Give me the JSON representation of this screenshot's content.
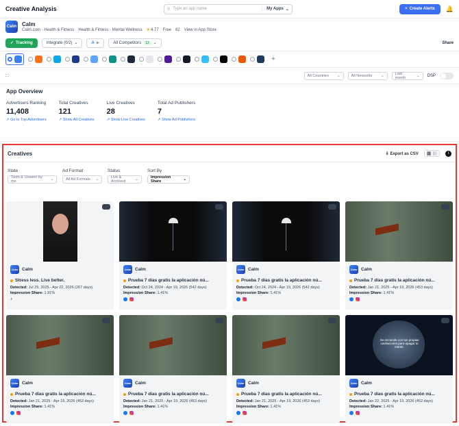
{
  "header": {
    "title": "Creative Analysis",
    "search_placeholder": "Type an app name",
    "my_apps": "My Apps",
    "create_alerts": "Create Alerts"
  },
  "app": {
    "name": "Calm",
    "logo_text": "Calm",
    "developer": "Calm.com - Health & Fitness",
    "category": "Health & Fitness - Mental Wellness",
    "rating": "4.77",
    "price": "Free",
    "downloads": "82",
    "store_link": "View in App Store"
  },
  "toolbar": {
    "tracking": "Tracking",
    "integrate": "Integrate (0/2)",
    "competitors": "All Competitors",
    "competitors_badge": "13",
    "share": "Share"
  },
  "app_icons": [
    "#3b82f6",
    "#f97316",
    "#0ea5e9",
    "#1e3a8a",
    "#60a5fa",
    "#0d9488",
    "#1e293b",
    "#e5e7eb",
    "#4c1d95",
    "#111827",
    "#38bdf8",
    "#000000",
    "#ea580c",
    "#1e3a5f"
  ],
  "filters": {
    "countries": "All Countries",
    "networks": "All Networks",
    "period": "Last month",
    "dsp": "DSP"
  },
  "overview": {
    "title": "App Overview",
    "stats": [
      {
        "label": "Advertisers Ranking",
        "value": "11,408",
        "link": "Go to Top Advertisers"
      },
      {
        "label": "Total Creatives",
        "value": "121",
        "link": "Show All Creatives"
      },
      {
        "label": "Live Creatives",
        "value": "28",
        "link": "Show Live Creatives"
      },
      {
        "label": "Total Ad Publishers",
        "value": "7",
        "link": "Show Ad Publishers"
      }
    ]
  },
  "creatives": {
    "title": "Creatives",
    "export": "Export as CSV",
    "filters": [
      {
        "label": "State",
        "value": "Seen & Unseen by me"
      },
      {
        "label": "Ad Format",
        "value": "All Ad Formats"
      },
      {
        "label": "Status",
        "value": "Live & Archived"
      },
      {
        "label": "Sort By",
        "value": "Impression Share"
      }
    ],
    "detected_label": "Detected:",
    "share_label": "Impression Share:",
    "cards": [
      {
        "brand": "Calm",
        "title": "Stress less. Live better.",
        "detected": "Jul 29, 2025 - Apr 22, 2026 (267 days)",
        "share": "1.91%",
        "thumb": "face",
        "platforms": [
          "tiktok"
        ]
      },
      {
        "brand": "Calm",
        "title": "Prueba 7 días gratis la aplicación nú...",
        "detected": "Oct 24, 2024 - Apr 19, 2026 (542 days)",
        "share": "1.41%",
        "thumb": "lamp",
        "platforms": [
          "facebook",
          "instagram"
        ]
      },
      {
        "brand": "Calm",
        "title": "Prueba 7 días gratis la aplicación nú...",
        "detected": "Oct 24, 2024 - Apr 19, 2026 (542 days)",
        "share": "1.41%",
        "thumb": "lamp",
        "platforms": [
          "facebook",
          "instagram"
        ]
      },
      {
        "brand": "Calm",
        "title": "Prueba 7 días gratis la aplicación nú...",
        "detected": "Jan 21, 2025 - Apr 19, 2026 (453 days)",
        "share": "1.41%",
        "thumb": "forest",
        "platforms": [
          "facebook",
          "instagram"
        ]
      },
      {
        "brand": "Calm",
        "title": "Prueba 7 días gratis la aplicación nú...",
        "detected": "Jan 21, 2025 - Apr 19, 2026 (453 days)",
        "share": "1.41%",
        "thumb": "forest",
        "platforms": [
          "facebook",
          "instagram"
        ]
      },
      {
        "brand": "Calm",
        "title": "Prueba 7 días gratis la aplicación nú...",
        "detected": "Jan 21, 2025 - Apr 19, 2026 (453 days)",
        "share": "1.41%",
        "thumb": "forest",
        "platforms": [
          "facebook",
          "instagram"
        ]
      },
      {
        "brand": "Calm",
        "title": "Prueba 7 días gratis la aplicación nú...",
        "detected": "Jan 21, 2025 - Apr 19, 2026 (453 days)",
        "share": "1.41%",
        "thumb": "forest",
        "platforms": [
          "facebook",
          "instagram"
        ]
      },
      {
        "brand": "Calm",
        "title": "Prueba 7 días gratis la aplicación nú...",
        "detected": "Jan 22, 2025 - Apr 19, 2026 (452 days)",
        "share": "1.41%",
        "thumb": "brain",
        "thumb_text": "Se enciende con tus propias cavilaciones para apagar tu mente.",
        "platforms": [
          "facebook",
          "instagram"
        ]
      }
    ]
  }
}
